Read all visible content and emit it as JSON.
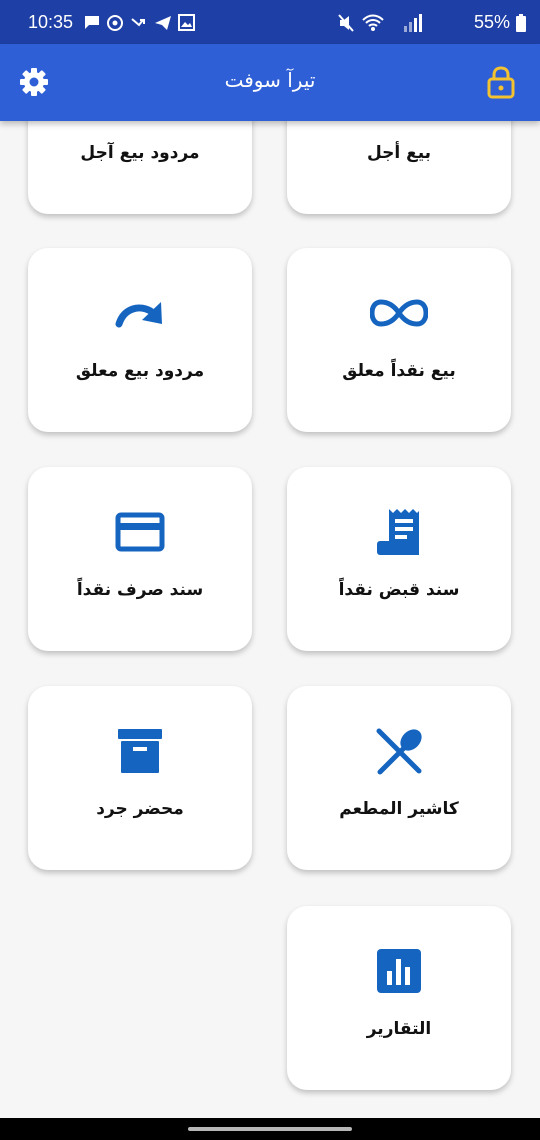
{
  "status_bar": {
    "time": "10:35",
    "battery": "55%"
  },
  "app_bar": {
    "title": "تيرآ سوفت"
  },
  "colors": {
    "app_bar": "#2f5fd6",
    "status_bar": "#1e3fa5",
    "icon": "#1565c0",
    "lock": "#f2c230"
  },
  "tiles": [
    {
      "label": "بيع أجل",
      "icon": "none"
    },
    {
      "label": "مردود بيع آجل",
      "icon": "none"
    },
    {
      "label": "بيع نقداً معلق",
      "icon": "infinity-icon"
    },
    {
      "label": "مردود بيع معلق",
      "icon": "redo-arrow-icon"
    },
    {
      "label": "سند قبض نقداً",
      "icon": "receipt-icon"
    },
    {
      "label": "سند صرف نقداً",
      "icon": "credit-card-icon"
    },
    {
      "label": "كاشير المطعم",
      "icon": "restaurant-icon"
    },
    {
      "label": "محضر جرد",
      "icon": "archive-box-icon"
    },
    {
      "label": "التقارير",
      "icon": "bar-chart-icon"
    }
  ]
}
